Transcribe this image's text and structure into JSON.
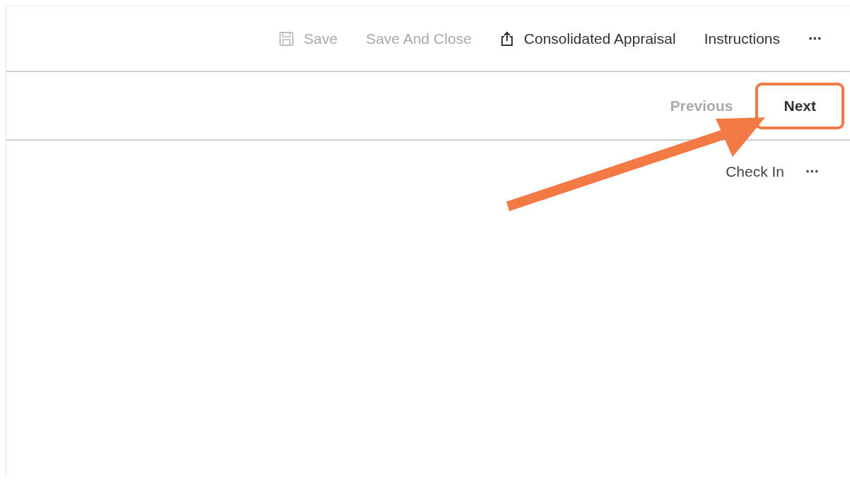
{
  "toolbar": {
    "items": [
      {
        "kind": "save",
        "label": "Save",
        "disabled": true
      },
      {
        "kind": "plain",
        "label": "Save And Close",
        "disabled": true
      },
      {
        "kind": "export",
        "label": "Consolidated Appraisal",
        "disabled": false
      },
      {
        "kind": "plain",
        "label": "Instructions",
        "disabled": false
      },
      {
        "kind": "more",
        "label": "···",
        "disabled": false
      }
    ]
  },
  "navigation": {
    "items": [
      {
        "label": "Previous",
        "disabled": true,
        "highlighted": false
      },
      {
        "label": "Next",
        "disabled": false,
        "highlighted": true
      }
    ]
  },
  "actions": {
    "items": [
      {
        "kind": "plain",
        "label": "Check In",
        "disabled": false
      },
      {
        "kind": "more",
        "label": "···",
        "disabled": false
      }
    ]
  }
}
